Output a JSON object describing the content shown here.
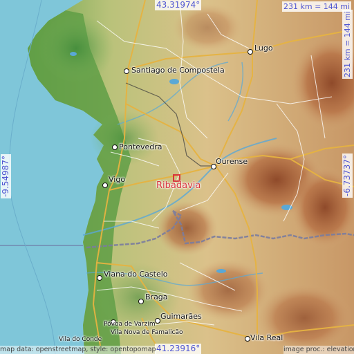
{
  "map": {
    "location": "Ribadavia",
    "colors": {
      "sea": "#7fc6d9",
      "lowland": "#5f9e45",
      "hills": "#d9bd84",
      "mountains": "#b0663c",
      "road_major": "#e6b341",
      "road_minor": "#ffffff",
      "border": "#7a7c9e",
      "marker": "#d8343c",
      "coordinates": "#4f55d2"
    },
    "coordinates": {
      "top": "43.31974°",
      "bottom": "41.23916°",
      "left": "-9.54987°",
      "right": "-6.73737°"
    },
    "scale": {
      "top": "231 km = 144 mi",
      "right": "231 km = 144 mi"
    },
    "cities": {
      "santiago": "Santiago de Compostela",
      "lugo": "Lugo",
      "pontevedra": "Pontevedra",
      "ourense": "Ourense",
      "vigo": "Vigo",
      "viana": "Viana do Castelo",
      "braga": "Braga",
      "povoa": "Póvoa de Varzim",
      "famalicao": "Vila Nova de Famalicão",
      "vila_do_conde": "Vila do Conde",
      "guimaraes": "Guimarães",
      "vila_real": "Vila Real"
    },
    "credits": {
      "left": "map data: openstreetmap, style: opentopomap",
      "right": "image proc.: elevation.city"
    }
  }
}
